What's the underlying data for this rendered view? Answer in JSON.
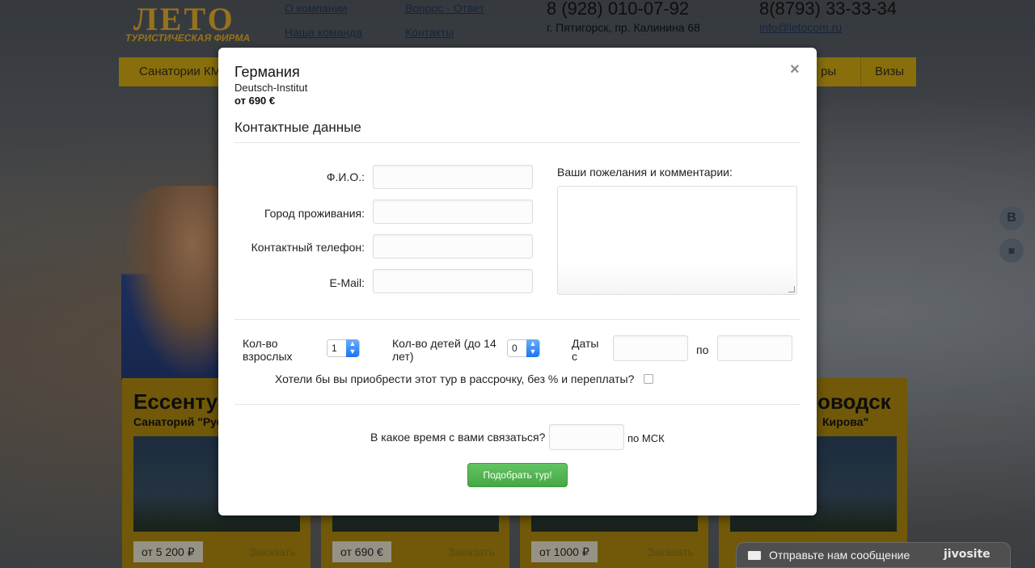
{
  "header": {
    "logo_main": "ЛЕТО",
    "logo_sub": "ТУРИСТИЧЕСКАЯ ФИРМА",
    "links": [
      "О компании",
      "Вопрос - Ответ",
      "Наша команда",
      "Контакты"
    ],
    "phone1": "8 (928) 010-07-92",
    "phone2": "8(8793) 33-33-34",
    "address": "г. Пятигорск, пр. Калинина 68",
    "email": "info@letocom.ru"
  },
  "menu": {
    "items": [
      "Санатории КМ",
      "ры",
      "Визы"
    ]
  },
  "cards": [
    {
      "title": "Ессенту",
      "subtitle": "Санаторий \"Рус",
      "price": "от 5 200 ₽",
      "order": "Заказать"
    },
    {
      "title": "",
      "subtitle": "",
      "price": "от 690 €",
      "order": "Заказать"
    },
    {
      "title": "",
      "subtitle": "",
      "price": "от 1000 ₽",
      "order": "Заказать"
    },
    {
      "title": "оводск",
      "subtitle": "Кирова\"",
      "price": "",
      "order": ""
    }
  ],
  "social": {
    "vk": "В",
    "instagram": "◙"
  },
  "modal": {
    "title": "Германия",
    "subtitle": "Deutsch-Institut",
    "price": "от 690 €",
    "close": "×",
    "section_title": "Контактные данные",
    "labels": {
      "name": "Ф.И.О.:",
      "city": "Город проживания:",
      "phone": "Контактный телефон:",
      "email": "E-Mail:",
      "comments": "Ваши пожелания и комментарии:",
      "adults": "Кол-во взрослых",
      "children": "Кол-во детей (до 14 лет)",
      "dates_from": "Даты с",
      "dates_to": "по",
      "installment": "Хотели бы вы приобрести этот тур в рассрочку, без % и переплаты?",
      "contact_time": "В какое время с вами связаться?",
      "msk": "по МСК"
    },
    "adults_value": "1",
    "children_value": "0",
    "submit": "Подобрать тур!"
  },
  "chat": {
    "text": "Отправьте нам сообщение",
    "brand": "jivosite"
  }
}
